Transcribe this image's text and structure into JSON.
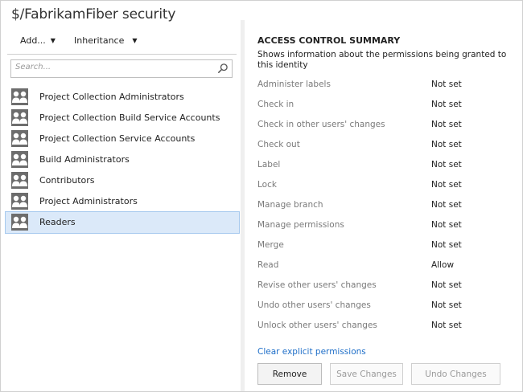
{
  "title": "$/FabrikamFiber security",
  "toolbar": {
    "add_label": "Add...",
    "inheritance_label": "Inheritance"
  },
  "search": {
    "placeholder": "Search..."
  },
  "groups": [
    {
      "label": "Project Collection Administrators"
    },
    {
      "label": "Project Collection Build Service Accounts"
    },
    {
      "label": "Project Collection Service Accounts"
    },
    {
      "label": "Build Administrators"
    },
    {
      "label": "Contributors"
    },
    {
      "label": "Project Administrators"
    },
    {
      "label": "Readers"
    }
  ],
  "selected_group": "Readers",
  "summary": {
    "heading": "ACCESS CONTROL SUMMARY",
    "description": "Shows information about the permissions being granted to this identity"
  },
  "permissions": [
    {
      "name": "Administer labels",
      "value": "Not set"
    },
    {
      "name": "Check in",
      "value": "Not set"
    },
    {
      "name": "Check in other users' changes",
      "value": "Not set"
    },
    {
      "name": "Check out",
      "value": "Not set"
    },
    {
      "name": "Label",
      "value": "Not set"
    },
    {
      "name": "Lock",
      "value": "Not set"
    },
    {
      "name": "Manage branch",
      "value": "Not set"
    },
    {
      "name": "Manage permissions",
      "value": "Not set"
    },
    {
      "name": "Merge",
      "value": "Not set"
    },
    {
      "name": "Read",
      "value": "Allow"
    },
    {
      "name": "Revise other users' changes",
      "value": "Not set"
    },
    {
      "name": "Undo other users' changes",
      "value": "Not set"
    },
    {
      "name": "Unlock other users' changes",
      "value": "Not set"
    }
  ],
  "clear_link": "Clear explicit permissions",
  "buttons": {
    "remove": "Remove",
    "save": "Save Changes",
    "undo": "Undo Changes"
  },
  "icons": {
    "group": "group-icon",
    "search": "search-icon",
    "caret": "chevron-down-icon"
  },
  "colors": {
    "link": "#1e6ec8",
    "selection": "#dbe9f9",
    "group_icon": "#6d6d6d"
  }
}
